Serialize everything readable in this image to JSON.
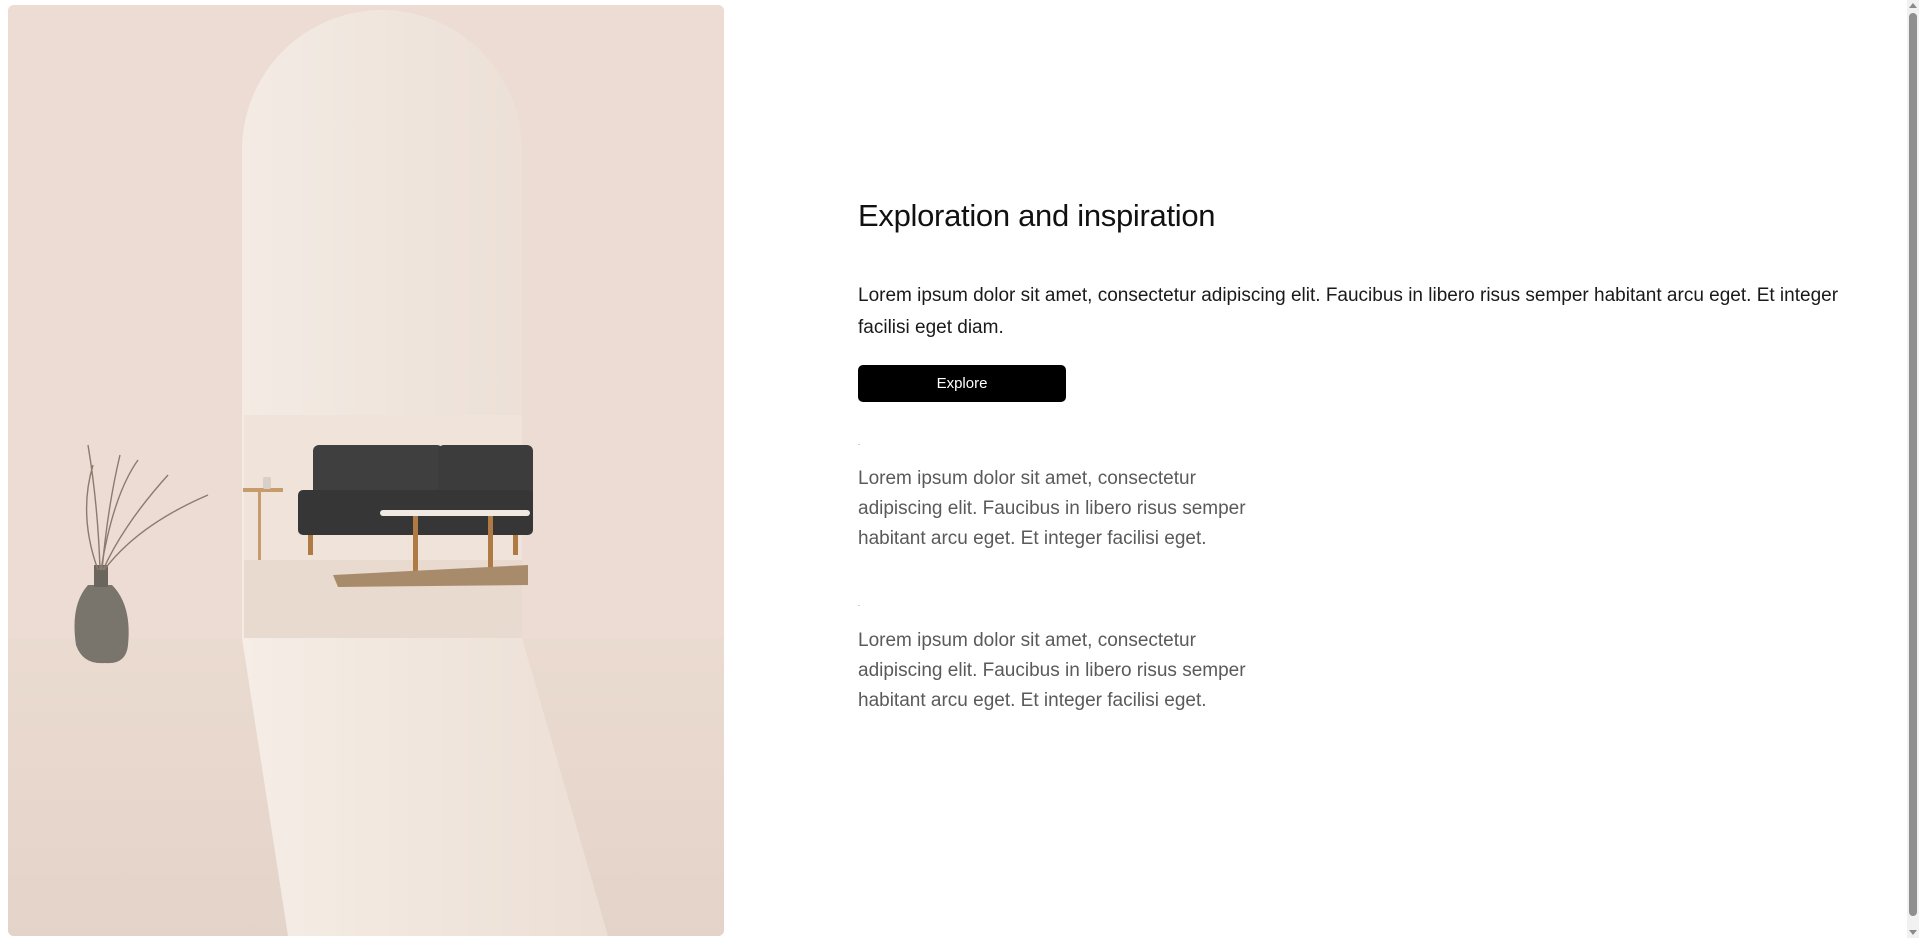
{
  "hero": {
    "image_name": "arched-living-room-photo",
    "colors": {
      "wall": "#ecdcd3",
      "arch": "#f1e6de",
      "sofa": "#3b3b3b",
      "wood": "#b07a45"
    }
  },
  "section": {
    "title": "Exploration and inspiration",
    "description": "Lorem ipsum dolor sit amet, consectetur adipiscing elit. Faucibus in libero risus semper habitant arcu eget. Et integer facilisi eget diam.",
    "cta_label": "Explore"
  },
  "features": [
    {
      "text": "Lorem ipsum dolor sit amet, consectetur adipiscing elit. Faucibus in libero risus semper habitant arcu eget. Et integer facilisi eget."
    },
    {
      "text": "Lorem ipsum dolor sit amet, consectetur adipiscing elit. Faucibus in libero risus semper habitant arcu eget. Et integer facilisi eget."
    }
  ],
  "theme": {
    "button_bg": "#000000",
    "button_text": "#ffffff",
    "muted_text": "#5a5a5a"
  }
}
